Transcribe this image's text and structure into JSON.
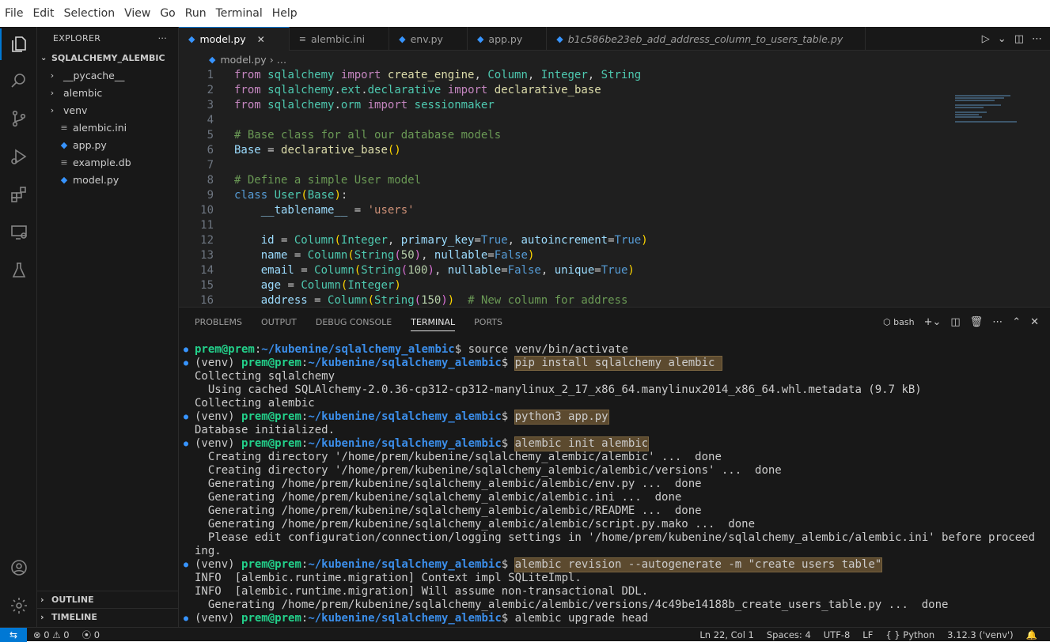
{
  "menu": [
    "File",
    "Edit",
    "Selection",
    "View",
    "Go",
    "Run",
    "Terminal",
    "Help"
  ],
  "explorer": {
    "title": "EXPLORER",
    "more": "···",
    "root": "SQLALCHEMY_ALEMBIC",
    "items": [
      {
        "label": "__pycache__",
        "type": "folder"
      },
      {
        "label": "alembic",
        "type": "folder"
      },
      {
        "label": "venv",
        "type": "folder"
      },
      {
        "label": "alembic.ini",
        "type": "file"
      },
      {
        "label": "app.py",
        "type": "python"
      },
      {
        "label": "example.db",
        "type": "file"
      },
      {
        "label": "model.py",
        "type": "python"
      }
    ],
    "outline": "OUTLINE",
    "timeline": "TIMELINE"
  },
  "tabs": [
    {
      "label": "model.py",
      "icon": "python-icon",
      "active": true
    },
    {
      "label": "alembic.ini",
      "icon": "settings-file-icon",
      "active": false
    },
    {
      "label": "env.py",
      "icon": "python-icon",
      "active": false
    },
    {
      "label": "app.py",
      "icon": "python-icon",
      "active": false
    },
    {
      "label": "b1c586be23eb_add_address_column_to_users_table.py",
      "icon": "python-icon",
      "active": false
    }
  ],
  "breadcrumb": {
    "file": "model.py",
    "rest": "› …"
  },
  "code_lines": [
    "1",
    "2",
    "3",
    "4",
    "5",
    "6",
    "7",
    "8",
    "9",
    "10",
    "11",
    "12",
    "13",
    "14",
    "15",
    "16"
  ],
  "panel": {
    "tabs": [
      "PROBLEMS",
      "OUTPUT",
      "DEBUG CONSOLE",
      "TERMINAL",
      "PORTS"
    ],
    "active_tab": "TERMINAL",
    "shell": "bash"
  },
  "terminal": {
    "prompt_user": "prem@prem",
    "prompt_path": "~/kubenine/sqlalchemy_alembic",
    "venv": "(venv) ",
    "lines": [
      {
        "dot": true,
        "venv": false,
        "cmd": "source venv/bin/activate",
        "hl": false
      },
      {
        "dot": true,
        "venv": true,
        "cmd": "pip install sqlalchemy alembic ",
        "hl": true
      },
      {
        "text": "Collecting sqlalchemy"
      },
      {
        "text": "  Using cached SQLAlchemy-2.0.36-cp312-cp312-manylinux_2_17_x86_64.manylinux2014_x86_64.whl.metadata (9.7 kB)"
      },
      {
        "text": "Collecting alembic"
      },
      {
        "dot": true,
        "venv": true,
        "cmd": "python3 app.py",
        "hl": true
      },
      {
        "text": "Database initialized."
      },
      {
        "dot": true,
        "venv": true,
        "cmd": "alembic init alembic",
        "hl": true
      },
      {
        "text": "  Creating directory '/home/prem/kubenine/sqlalchemy_alembic/alembic' ...  done"
      },
      {
        "text": "  Creating directory '/home/prem/kubenine/sqlalchemy_alembic/alembic/versions' ...  done"
      },
      {
        "text": "  Generating /home/prem/kubenine/sqlalchemy_alembic/alembic/env.py ...  done"
      },
      {
        "text": "  Generating /home/prem/kubenine/sqlalchemy_alembic/alembic.ini ...  done"
      },
      {
        "text": "  Generating /home/prem/kubenine/sqlalchemy_alembic/alembic/README ...  done"
      },
      {
        "text": "  Generating /home/prem/kubenine/sqlalchemy_alembic/alembic/script.py.mako ...  done"
      },
      {
        "text": "  Please edit configuration/connection/logging settings in '/home/prem/kubenine/sqlalchemy_alembic/alembic.ini' before proceed"
      },
      {
        "text": "ing."
      },
      {
        "dot": true,
        "venv": true,
        "cmd": "alembic revision --autogenerate -m \"create users table\"",
        "hl": true
      },
      {
        "text": "INFO  [alembic.runtime.migration] Context impl SQLiteImpl."
      },
      {
        "text": "INFO  [alembic.runtime.migration] Will assume non-transactional DDL."
      },
      {
        "text": "  Generating /home/prem/kubenine/sqlalchemy_alembic/alembic/versions/4c49be14188b_create_users_table.py ...  done"
      },
      {
        "dot": true,
        "venv": true,
        "cmd": "alembic upgrade head",
        "hl": false
      }
    ]
  },
  "status": {
    "errors": "0",
    "warnings": "0",
    "ports": "0",
    "position": "Ln 22, Col 1",
    "spaces": "Spaces: 4",
    "encoding": "UTF-8",
    "eol": "LF",
    "language": "Python",
    "interpreter": "3.12.3 ('venv')",
    "language_prefix": "{ }"
  },
  "colors": {
    "accent": "#0078d4",
    "prompt_user": "#23d18b",
    "prompt_path": "#3b8eea"
  }
}
